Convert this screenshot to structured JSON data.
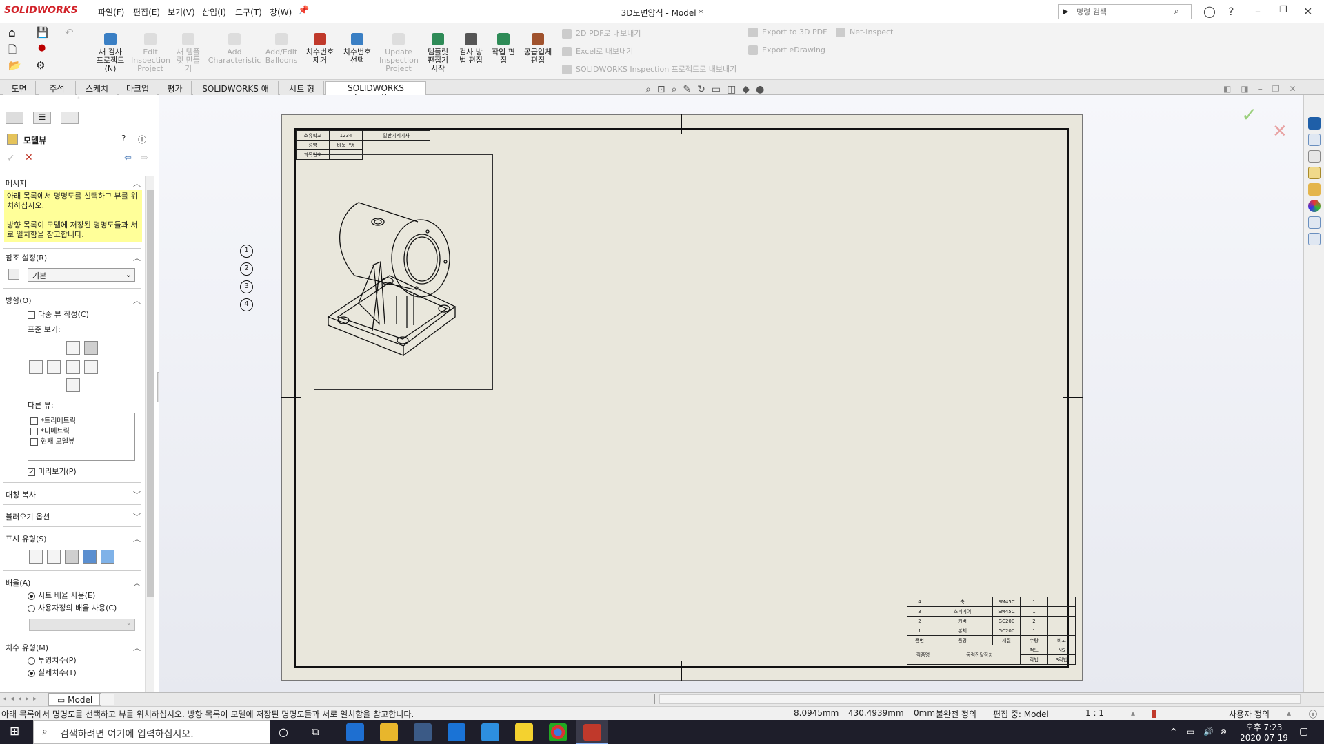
{
  "app": {
    "brand": "SOLIDWORKS",
    "window_title": "3D도면양식 - Model *",
    "menus": [
      "파일(F)",
      "편집(E)",
      "보기(V)",
      "삽입(I)",
      "도구(T)",
      "창(W)"
    ],
    "search_placeholder": "명령 검색"
  },
  "commands": [
    {
      "label": "새 검사\n프로젝트\n(N)",
      "enabled": true
    },
    {
      "label": "Edit\nInspection\nProject",
      "enabled": false
    },
    {
      "label": "새 템플\n릿 만들\n기",
      "enabled": false
    },
    {
      "label": "Add\nCharacteristic",
      "enabled": false
    },
    {
      "label": "Add/Edit\nBalloons",
      "enabled": false
    },
    {
      "label": "치수번호\n제거",
      "enabled": true
    },
    {
      "label": "치수번호\n선택",
      "enabled": true
    },
    {
      "label": "Update\nInspection\nProject",
      "enabled": false
    },
    {
      "label": "템플릿\n편집기\n시작",
      "enabled": true
    },
    {
      "label": "검사 방\n법 편집",
      "enabled": true
    },
    {
      "label": "작업 편\n집",
      "enabled": true
    },
    {
      "label": "공급업체\n편집",
      "enabled": true
    }
  ],
  "exports": [
    "2D PDF로 내보내기",
    "Excel로 내보내기",
    "SOLIDWORKS Inspection 프로젝트로 내보내기",
    "Export to 3D PDF",
    "Export eDrawing",
    "Net-Inspect"
  ],
  "tabs": [
    "도면",
    "주석",
    "스케치",
    "마크업",
    "평가",
    "SOLIDWORKS 애드인",
    "시트 형식",
    "SOLIDWORKS Inspection"
  ],
  "active_tab": "SOLIDWORKS Inspection",
  "panel": {
    "title": "모델뷰",
    "message_header": "메시지",
    "message": "아래 목록에서 명명도를 선택하고 뷰를 위치하십시오.\n\n방향 목록이 모델에 저장된 명명도들과 서로 일치함을 참고합니다.",
    "ref_header": "참조 설정(R)",
    "ref_value": "기본",
    "orient_header": "방향(O)",
    "multi_view": "다중 뷰 작성(C)",
    "std_views": "표준 보기:",
    "more_views": "다른 뷰:",
    "more_views_items": [
      "*트리메트릭",
      "*디메트릭",
      "현재 모델뷰"
    ],
    "preview": "미리보기(P)",
    "mirror_copy": "대칭 복사",
    "import_opts": "불러오기 옵션",
    "display_style": "표시 유형(S)",
    "scale_header": "배율(A)",
    "scale_sheet": "시트 배율 사용(E)",
    "scale_custom": "사용자정의 배율 사용(C)",
    "dim_header": "치수 유형(M)",
    "dim_proj": "투영치수(P)",
    "dim_true": "실제치수(T)"
  },
  "drawing": {
    "balloons": [
      "1",
      "2",
      "3",
      "4"
    ],
    "title_top": [
      [
        "소유학교",
        "1234",
        "일반기계기사"
      ],
      [
        "성명",
        "바둑구멍",
        ""
      ],
      [
        "과목번호",
        "",
        ""
      ]
    ],
    "bom_rows": [
      [
        "4",
        "축",
        "SM45C",
        "1",
        ""
      ],
      [
        "3",
        "스퍼기어",
        "SM45C",
        "1",
        ""
      ],
      [
        "2",
        "커버",
        "GC200",
        "2",
        ""
      ],
      [
        "1",
        "본체",
        "GC200",
        "1",
        ""
      ]
    ],
    "bom_header": [
      "품번",
      "품명",
      "재질",
      "수량",
      "비고"
    ],
    "title_block": [
      "작품명",
      "동력전달장치",
      "척도",
      "NS",
      "각법",
      "3각법"
    ]
  },
  "bottom_tab": "Model",
  "status": {
    "message": "아래 목록에서 명명도를 선택하고 뷰를 위치하십시오. 방향 목록이 모델에 저장된 명명도들과 서로 일치함을 참고합니다.",
    "x": "8.0945mm",
    "y": "430.4939mm",
    "z": "0mm",
    "define": "불완전 정의",
    "editing": "편집 중: Model",
    "scale": "1 : 1",
    "custom": "사용자 정의"
  },
  "taskbar": {
    "search": "검색하려면 여기에 입력하십시오.",
    "time": "오후 7:23",
    "date": "2020-07-19"
  },
  "colors": {
    "accent": "#d2232a",
    "message_bg": "#ffff99",
    "sheet": "#e9e7dc"
  }
}
